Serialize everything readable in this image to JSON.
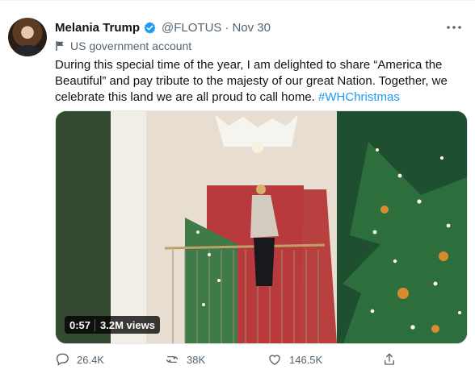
{
  "tweet": {
    "author_name": "Melania Trump",
    "handle": "@FLOTUS",
    "separator": "·",
    "date": "Nov 30",
    "account_label": "US government account",
    "text_main": "During this special time of the year, I am delighted to share “America the Beautiful” and pay tribute to the majesty of our great Nation. Together, we celebrate this land we are all proud to call home.",
    "hashtag": "#WHChristmas",
    "video": {
      "duration": "0:57",
      "views": "3.2M views"
    },
    "actions": {
      "replies": "26.4K",
      "retweets": "38K",
      "likes": "146.5K"
    }
  },
  "colors": {
    "brand": "#1d9bf0",
    "secondary_text": "#536471",
    "primary_text": "#0f1419",
    "border": "#e7e9ea"
  },
  "icons": {
    "verified": "verified-badge-icon",
    "more": "more-icon",
    "flag": "flag-icon",
    "reply": "reply-icon",
    "retweet": "retweet-icon",
    "like": "heart-icon",
    "share": "share-icon"
  }
}
